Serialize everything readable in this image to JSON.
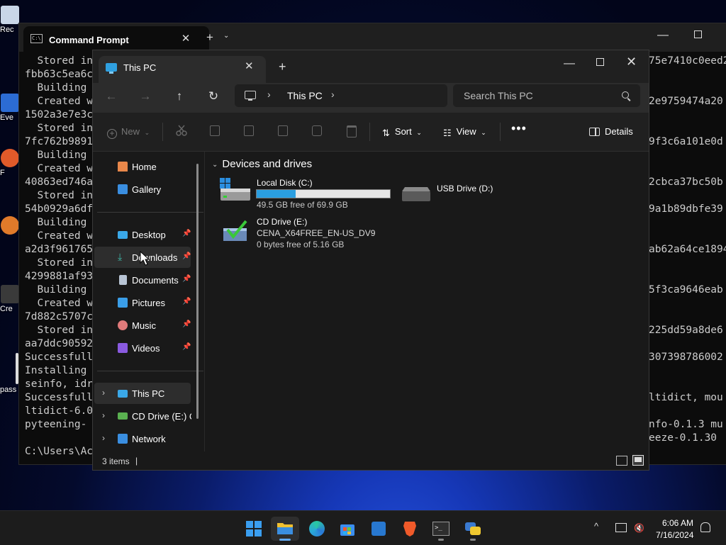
{
  "desktop": {
    "icons": [
      {
        "label": "Rec",
        "color": "#c9d6e8"
      },
      {
        "label": "Eve",
        "color": "#2c6cd4"
      },
      {
        "label": "F",
        "color": "#e05a2a"
      },
      {
        "label": "",
        "color": "#e07a2a"
      },
      {
        "label": "Cre",
        "color": "#3a3a3a"
      },
      {
        "label": "pass",
        "color": "#dddddd"
      }
    ]
  },
  "cmd": {
    "tab_title": "Command Prompt",
    "tab_close": "✕",
    "new_tab": "+",
    "dropdown": "⌄",
    "minimize": "—",
    "left_lines": [
      "  Stored in",
      "fbb63c5ea6c",
      "  Building",
      "  Created w",
      "1502a3e7e3c",
      "  Stored in",
      "7fc762b9891",
      "  Building",
      "  Created w",
      "40863ed746a",
      "  Stored in",
      "54b0929a6df",
      "  Building",
      "  Created w",
      "a2d3f961765",
      "  Stored in",
      "4299881af93",
      "  Building",
      "  Created w",
      "7d882c5707c",
      "  Stored in",
      "aa7ddc90592",
      "Successfull",
      "Installing",
      "seinfo, idr",
      "Successfull",
      "ltidict-6.0",
      "pyteening-",
      "",
      "C:\\Users\\Ac"
    ],
    "right_lines": [
      "75e7410c0eed2",
      "",
      "",
      "2e9759474a20",
      "",
      "",
      "9f3c6a101e0d",
      "",
      "",
      "2cbca37bc50b",
      "",
      "9a1b89dbfe39",
      "",
      "",
      "ab62a64ce1894",
      "",
      "",
      "5f3ca9646eab",
      "",
      "",
      "225dd59a8de6",
      "",
      "307398786002",
      "",
      "",
      "ltidict, mou",
      "",
      "nfo-0.1.3 mu",
      "eeze-0.1.30",
      ""
    ]
  },
  "explorer": {
    "tab_title": "This PC",
    "tab_close": "✕",
    "new_tab": "+",
    "window_controls": {
      "minimize": "—",
      "close": "✕"
    },
    "nav": {
      "back": "←",
      "forward": "→",
      "up": "↑",
      "refresh": "↻"
    },
    "address": {
      "chevron": "›",
      "location": "This PC"
    },
    "search": {
      "placeholder": "Search This PC"
    },
    "toolbar": {
      "new_label": "New",
      "new_glyph": "+",
      "sort_label": "Sort",
      "view_label": "View",
      "dropdown_glyph": "⌄",
      "more_glyph": "•••",
      "details_label": "Details",
      "icons": [
        "cut-icon",
        "copy-icon",
        "paste-icon",
        "rename-icon",
        "share-icon",
        "delete-icon"
      ]
    },
    "sidebar": {
      "pin_glyph": "📌",
      "expand_glyph": "›",
      "quick": [
        {
          "label": "Home",
          "icon": "home-icon",
          "color": "#e8874a"
        },
        {
          "label": "Gallery",
          "icon": "gallery-icon",
          "color": "#3a8ee0"
        }
      ],
      "pinned": [
        {
          "label": "Desktop",
          "icon": "desktop-icon",
          "color": "#3aa8e8"
        },
        {
          "label": "Downloads",
          "icon": "download-icon",
          "color": "#3fb8a8"
        },
        {
          "label": "Documents",
          "icon": "documents-icon",
          "color": "#b8c4d4"
        },
        {
          "label": "Pictures",
          "icon": "pictures-icon",
          "color": "#3a9ee8"
        },
        {
          "label": "Music",
          "icon": "music-icon",
          "color": "#e07a7a"
        },
        {
          "label": "Videos",
          "icon": "videos-icon",
          "color": "#8a5ae0"
        }
      ],
      "locations": [
        {
          "label": "This PC",
          "icon": "pc-icon",
          "color": "#3aa8e8"
        },
        {
          "label": "CD Drive (E:) CE",
          "icon": "cd-drive-icon",
          "color": "#5ab050"
        },
        {
          "label": "Network",
          "icon": "network-icon",
          "color": "#3a8ee0"
        }
      ]
    },
    "content": {
      "group_title": "Devices and drives",
      "group_chevron": "⌄",
      "drives": [
        {
          "name": "Local Disk (C:)",
          "free_text": "49.5 GB free of 69.9 GB",
          "used_fraction": 0.292
        },
        {
          "name": "USB Drive (D:)"
        },
        {
          "name": "CD Drive (E:)",
          "label": "CENA_X64FREE_EN-US_DV9",
          "free_text": "0 bytes free of 5.16 GB"
        }
      ]
    },
    "status": {
      "item_count": "3 items",
      "caret": "|"
    }
  },
  "taskbar": {
    "apps": [
      {
        "name": "start",
        "color": "#3a9ef0"
      },
      {
        "name": "file-explorer",
        "color": "#f0c030",
        "active": true
      },
      {
        "name": "edge",
        "color": "#2aa8d8"
      },
      {
        "name": "store",
        "color": "#3a8ef0"
      },
      {
        "name": "outlook",
        "color": "#2878d0"
      },
      {
        "name": "brave",
        "color": "#f05a2a"
      },
      {
        "name": "terminal",
        "color": "#3a3a3a"
      },
      {
        "name": "python",
        "color": "#3a7ad0"
      }
    ],
    "tray_chevron": "^",
    "time": "6:06 AM",
    "date": "7/16/2024"
  }
}
